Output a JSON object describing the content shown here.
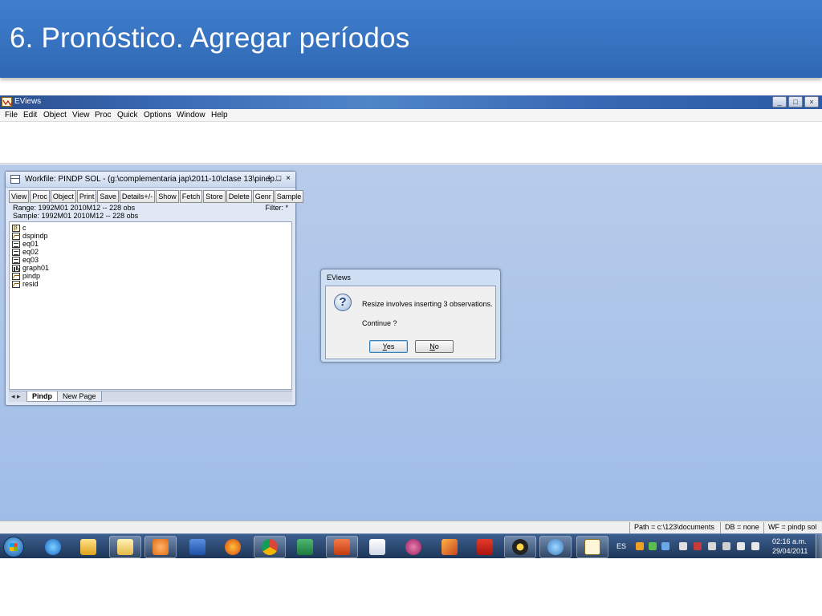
{
  "slide": {
    "title": "6. Pronóstico. Agregar períodos"
  },
  "app": {
    "title": "EViews",
    "window_buttons": [
      "_",
      "□",
      "×"
    ],
    "menu": [
      "File",
      "Edit",
      "Object",
      "View",
      "Proc",
      "Quick",
      "Options",
      "Window",
      "Help"
    ]
  },
  "workfile": {
    "title": "Workfile: PINDP SOL - (g:\\complementaria jap\\2011-10\\clase 13\\pindp...",
    "controls": [
      "–",
      "□",
      "×"
    ],
    "toolbar": [
      "View",
      "Proc",
      "Object",
      "Print",
      "Save",
      "Details+/-",
      "Show",
      "Fetch",
      "Store",
      "Delete",
      "Genr",
      "Sample"
    ],
    "range": "Range:  1992M01 2010M12  --  228 obs",
    "sample": "Sample: 1992M01 2010M12  --  228 obs",
    "filter": "Filter: *",
    "objects": [
      {
        "name": "c",
        "icon": "coef-icon"
      },
      {
        "name": "dspindp",
        "icon": "series-icon"
      },
      {
        "name": "eq01",
        "icon": "equation-icon"
      },
      {
        "name": "eq02",
        "icon": "equation-icon"
      },
      {
        "name": "eq03",
        "icon": "equation-icon"
      },
      {
        "name": "graph01",
        "icon": "graph-icon"
      },
      {
        "name": "pindp",
        "icon": "series-icon"
      },
      {
        "name": "resid",
        "icon": "series-icon"
      }
    ],
    "tab_nav": "◂ ▸",
    "tabs": [
      "Pindp",
      "New Page"
    ],
    "active_tab": "Pindp"
  },
  "dialog": {
    "title": "EViews",
    "message": "Resize involves inserting 3 observations.",
    "question": "Continue ?",
    "icon": "question-icon",
    "yes_accel": "Y",
    "yes_rest": "es",
    "no_accel": "N",
    "no_rest": "o"
  },
  "statusbar": {
    "path": "Path = c:\\123\\documents",
    "db": "DB = none",
    "wf": "WF = pindp sol"
  },
  "taskbar": {
    "apps": [
      "internet-explorer-icon",
      "outlook-icon",
      "explorer-icon",
      "media-player-icon",
      "word-icon",
      "firefox-icon",
      "chrome-icon",
      "excel-icon",
      "powerpoint-icon",
      "calendar-icon",
      "app-icon",
      "matlab-icon",
      "acrobat-icon",
      "webcam-icon",
      "paint-icon",
      "eviews-icon"
    ],
    "lang": "ES",
    "time": "02:16 a.m.",
    "date": "29/04/2011"
  },
  "colors": {
    "slide_header": "#3374c2",
    "desktop": "#a9c3e9",
    "taskbar": "#2a4670"
  }
}
